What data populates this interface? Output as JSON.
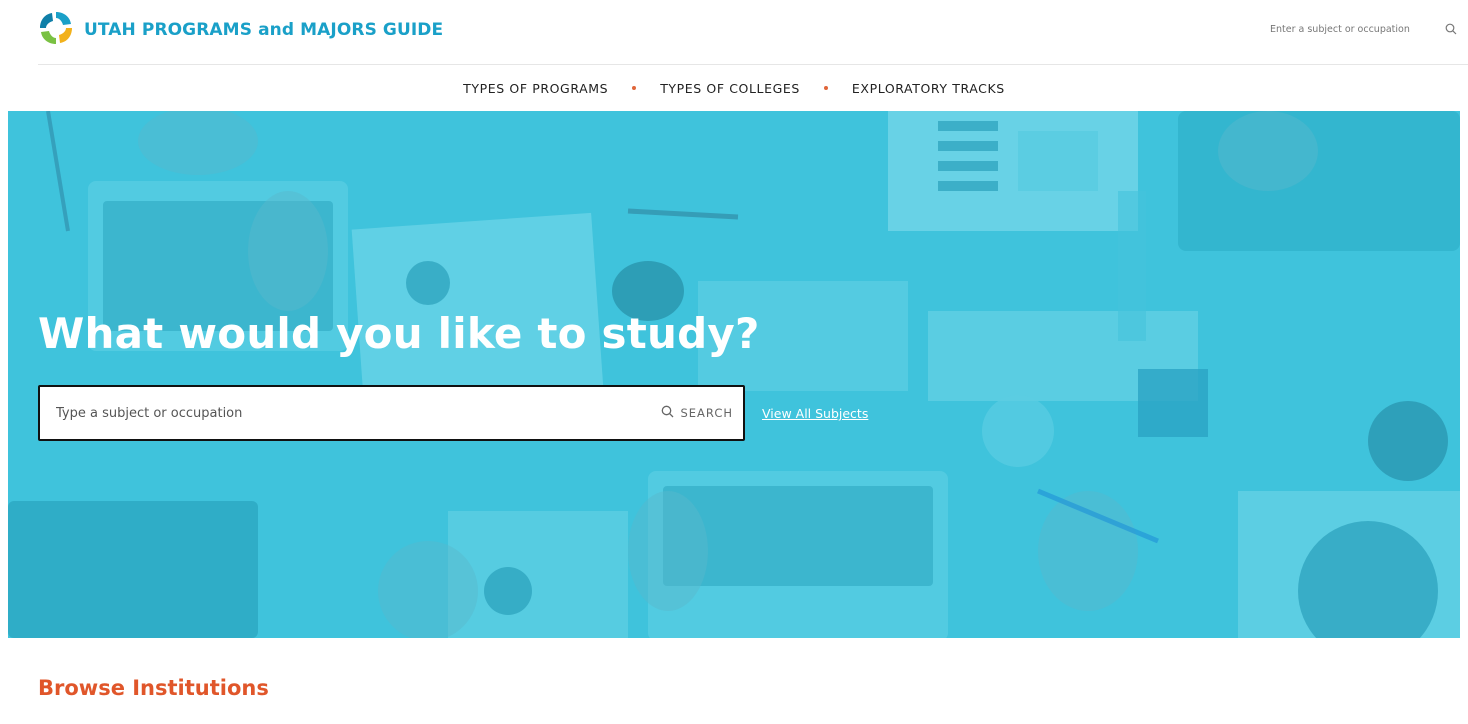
{
  "header": {
    "brand_title": "UTAH PROGRAMS and MAJORS GUIDE",
    "logo_icon": "utah-pinwheel-logo-icon",
    "search_placeholder": "Enter a subject or occupation",
    "search_icon": "search-icon"
  },
  "nav": {
    "items": [
      {
        "label": "TYPES OF PROGRAMS"
      },
      {
        "label": "TYPES OF COLLEGES"
      },
      {
        "label": "EXPLORATORY TRACKS"
      }
    ],
    "separator_color": "#e0663a"
  },
  "hero": {
    "title": "What would you like to study?",
    "search_placeholder": "Type a subject or occupation",
    "search_button_label": "SEARCH",
    "view_all_label": "View All Subjects",
    "overlay_color": "#3fc3dc"
  },
  "browse": {
    "title": "Browse Institutions"
  },
  "colors": {
    "brand": "#1aa0c8",
    "accent": "#e0562a"
  }
}
